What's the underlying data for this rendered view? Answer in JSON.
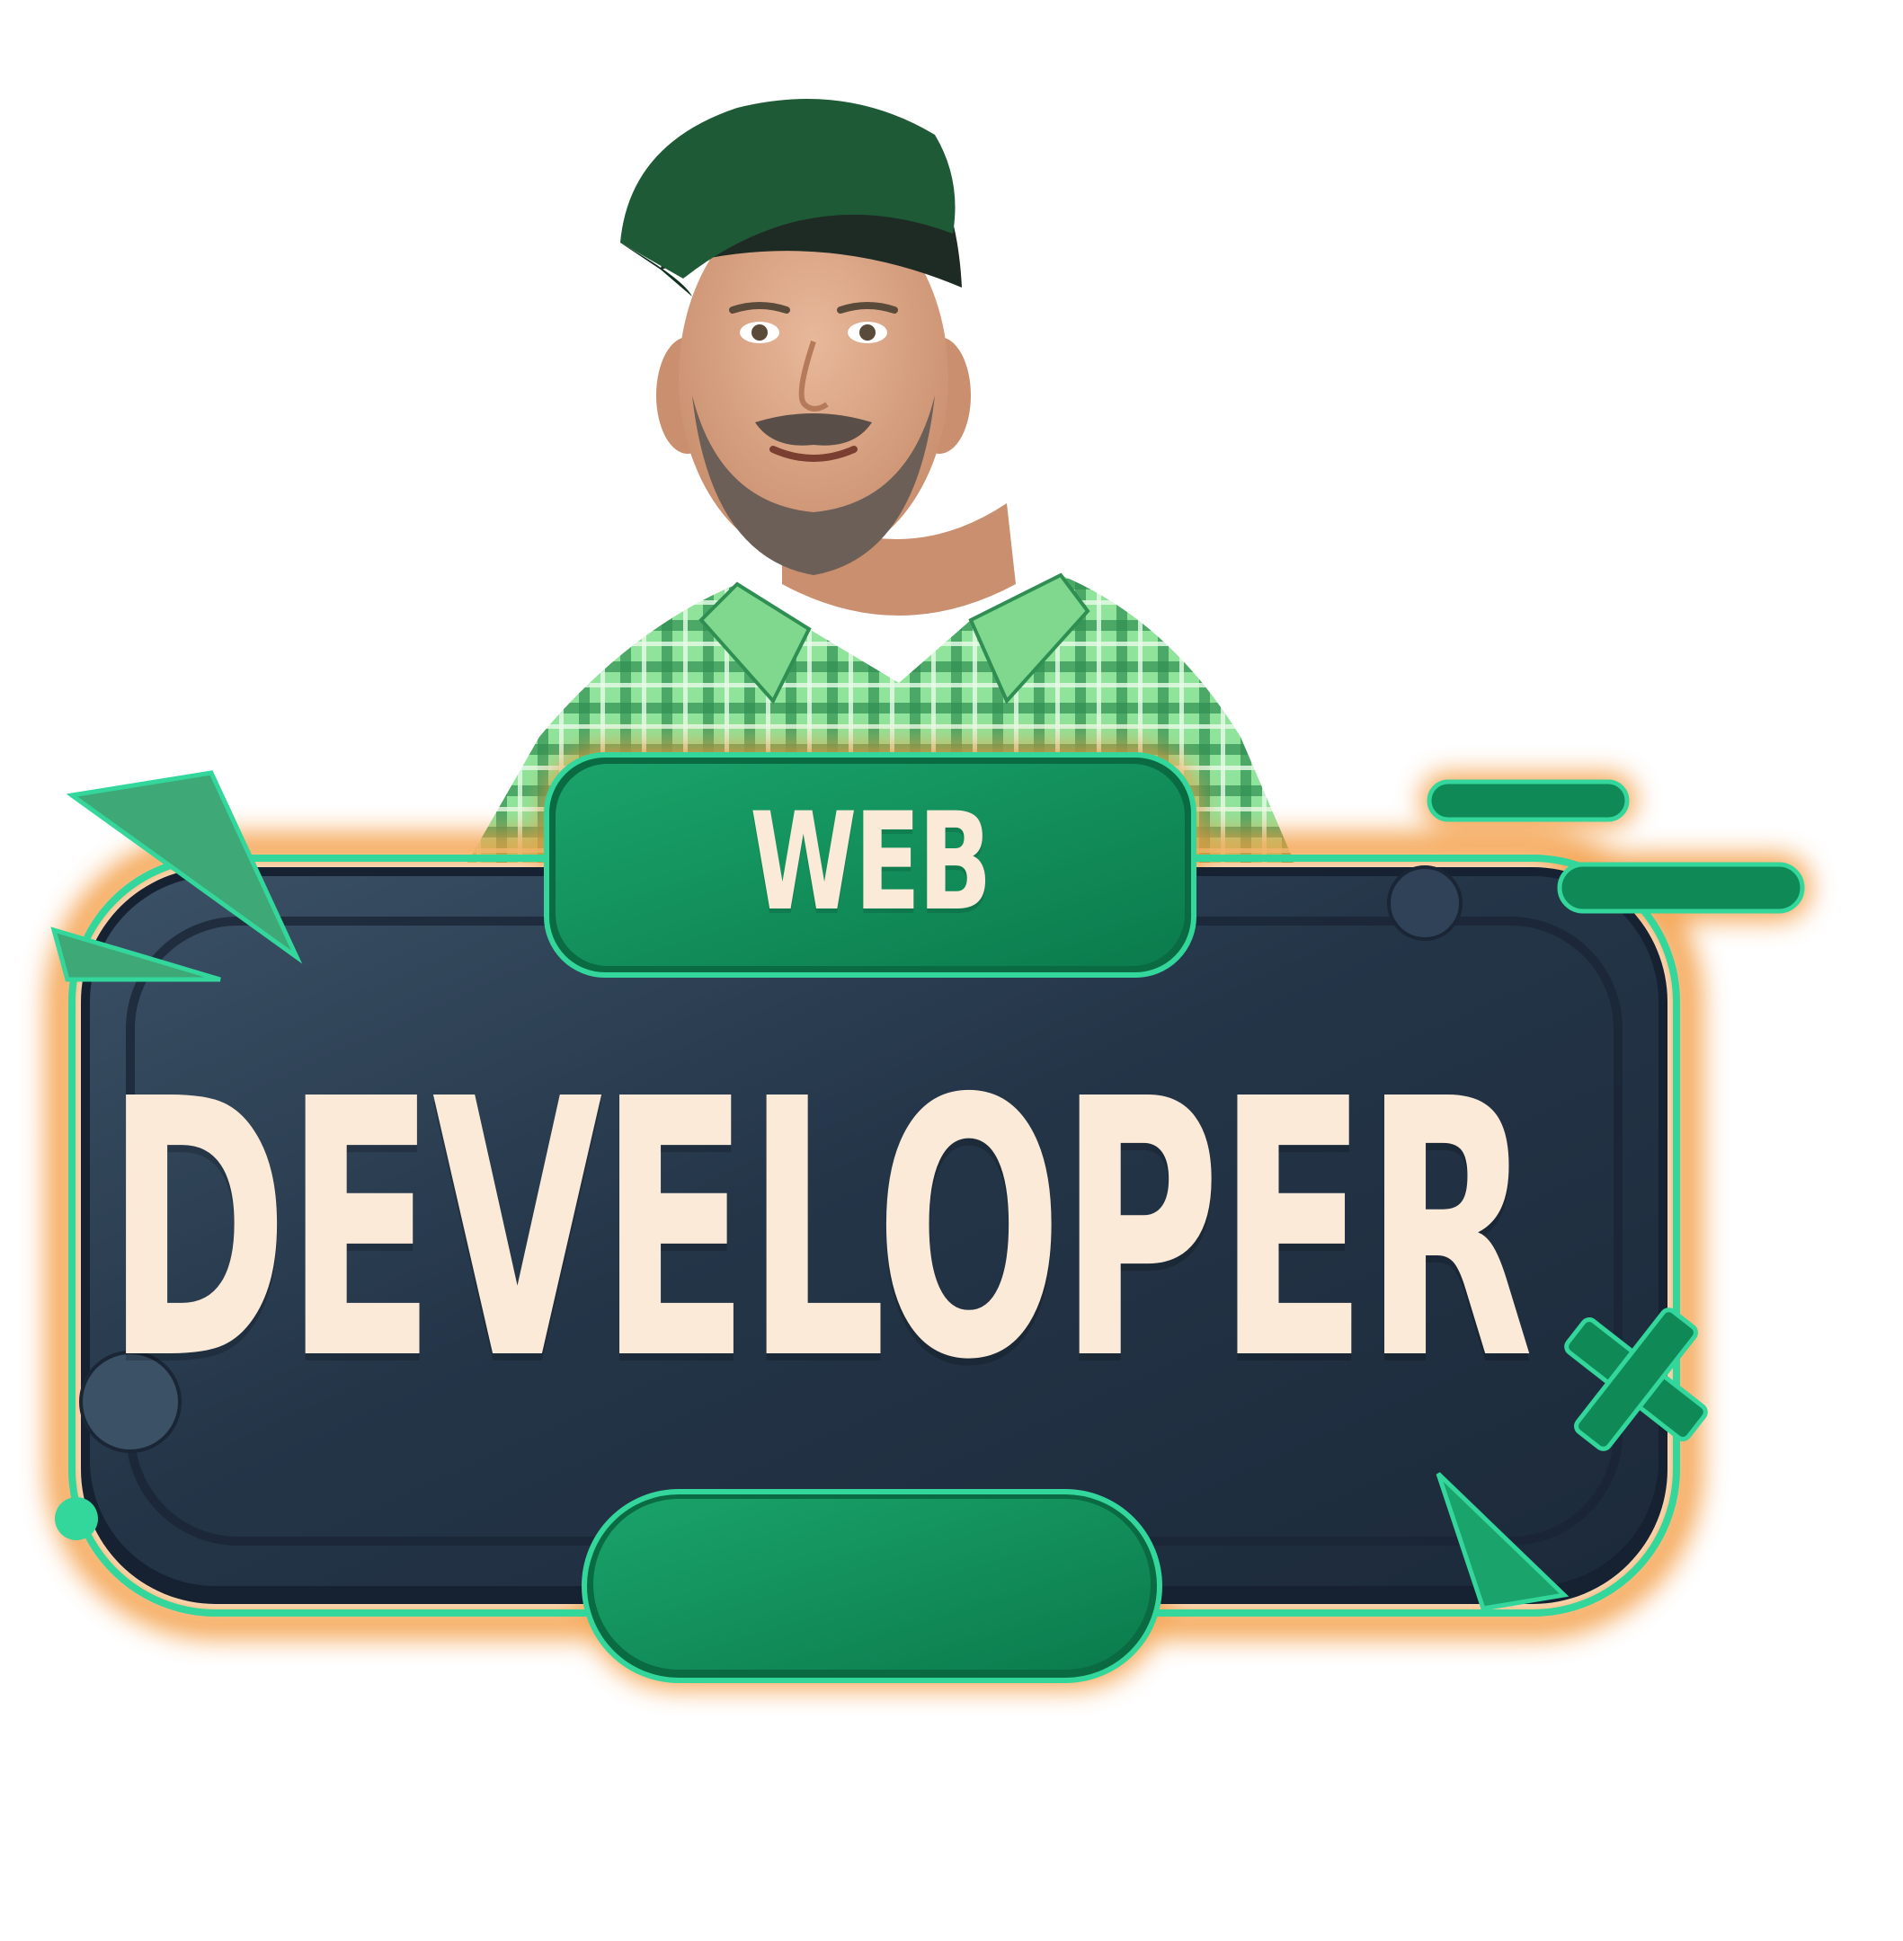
{
  "badge": {
    "top_label": "WEB",
    "main_label": "DEVELOPER"
  },
  "colors": {
    "panel_dark": "#1f2f42",
    "panel_light": "#3b5166",
    "accent_green": "#0f8a57",
    "accent_green_light": "#1aa36a",
    "glow_orange": "#f39a3c",
    "outline_mint": "#33d69b",
    "text_cream": "#fbead8",
    "shirt_green": "#8fe39b",
    "cap_green": "#1f5a37"
  },
  "icons": {
    "person": "person-portrait",
    "x_mark": "x-mark-icon",
    "triangles": "triangle-shape-icon"
  }
}
